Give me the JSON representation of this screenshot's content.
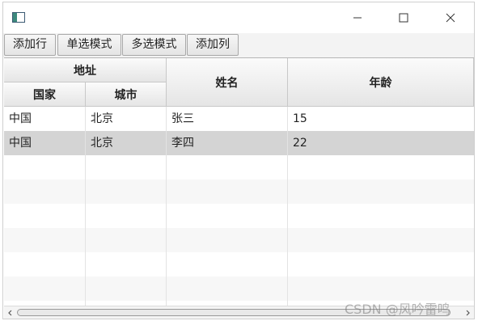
{
  "window": {
    "title": "",
    "icon": "app-window-icon"
  },
  "toolbar": {
    "add_row": "添加行",
    "single_select": "单选模式",
    "multi_select": "多选模式",
    "add_column": "添加列"
  },
  "table": {
    "headers": {
      "address": "地址",
      "country": "国家",
      "city": "城市",
      "name": "姓名",
      "age": "年龄"
    },
    "rows": [
      {
        "country": "中国",
        "city": "北京",
        "name": "张三",
        "age": "15"
      },
      {
        "country": "中国",
        "city": "北京",
        "name": "李四",
        "age": "22"
      }
    ],
    "selected_row_index": 1
  },
  "watermark": "CSDN @风吟雷鸣"
}
